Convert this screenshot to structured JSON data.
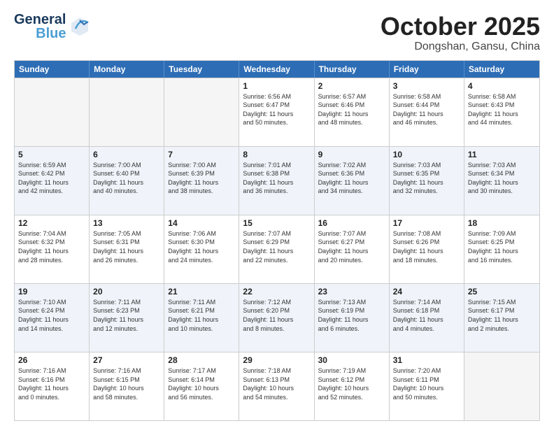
{
  "header": {
    "logo": {
      "part1": "General",
      "part2": "Blue"
    },
    "month": "October 2025",
    "location": "Dongshan, Gansu, China"
  },
  "weekdays": [
    "Sunday",
    "Monday",
    "Tuesday",
    "Wednesday",
    "Thursday",
    "Friday",
    "Saturday"
  ],
  "rows": [
    {
      "alt": false,
      "cells": [
        {
          "empty": true,
          "day": "",
          "info": ""
        },
        {
          "empty": true,
          "day": "",
          "info": ""
        },
        {
          "empty": true,
          "day": "",
          "info": ""
        },
        {
          "empty": false,
          "day": "1",
          "info": "Sunrise: 6:56 AM\nSunset: 6:47 PM\nDaylight: 11 hours\nand 50 minutes."
        },
        {
          "empty": false,
          "day": "2",
          "info": "Sunrise: 6:57 AM\nSunset: 6:46 PM\nDaylight: 11 hours\nand 48 minutes."
        },
        {
          "empty": false,
          "day": "3",
          "info": "Sunrise: 6:58 AM\nSunset: 6:44 PM\nDaylight: 11 hours\nand 46 minutes."
        },
        {
          "empty": false,
          "day": "4",
          "info": "Sunrise: 6:58 AM\nSunset: 6:43 PM\nDaylight: 11 hours\nand 44 minutes."
        }
      ]
    },
    {
      "alt": true,
      "cells": [
        {
          "empty": false,
          "day": "5",
          "info": "Sunrise: 6:59 AM\nSunset: 6:42 PM\nDaylight: 11 hours\nand 42 minutes."
        },
        {
          "empty": false,
          "day": "6",
          "info": "Sunrise: 7:00 AM\nSunset: 6:40 PM\nDaylight: 11 hours\nand 40 minutes."
        },
        {
          "empty": false,
          "day": "7",
          "info": "Sunrise: 7:00 AM\nSunset: 6:39 PM\nDaylight: 11 hours\nand 38 minutes."
        },
        {
          "empty": false,
          "day": "8",
          "info": "Sunrise: 7:01 AM\nSunset: 6:38 PM\nDaylight: 11 hours\nand 36 minutes."
        },
        {
          "empty": false,
          "day": "9",
          "info": "Sunrise: 7:02 AM\nSunset: 6:36 PM\nDaylight: 11 hours\nand 34 minutes."
        },
        {
          "empty": false,
          "day": "10",
          "info": "Sunrise: 7:03 AM\nSunset: 6:35 PM\nDaylight: 11 hours\nand 32 minutes."
        },
        {
          "empty": false,
          "day": "11",
          "info": "Sunrise: 7:03 AM\nSunset: 6:34 PM\nDaylight: 11 hours\nand 30 minutes."
        }
      ]
    },
    {
      "alt": false,
      "cells": [
        {
          "empty": false,
          "day": "12",
          "info": "Sunrise: 7:04 AM\nSunset: 6:32 PM\nDaylight: 11 hours\nand 28 minutes."
        },
        {
          "empty": false,
          "day": "13",
          "info": "Sunrise: 7:05 AM\nSunset: 6:31 PM\nDaylight: 11 hours\nand 26 minutes."
        },
        {
          "empty": false,
          "day": "14",
          "info": "Sunrise: 7:06 AM\nSunset: 6:30 PM\nDaylight: 11 hours\nand 24 minutes."
        },
        {
          "empty": false,
          "day": "15",
          "info": "Sunrise: 7:07 AM\nSunset: 6:29 PM\nDaylight: 11 hours\nand 22 minutes."
        },
        {
          "empty": false,
          "day": "16",
          "info": "Sunrise: 7:07 AM\nSunset: 6:27 PM\nDaylight: 11 hours\nand 20 minutes."
        },
        {
          "empty": false,
          "day": "17",
          "info": "Sunrise: 7:08 AM\nSunset: 6:26 PM\nDaylight: 11 hours\nand 18 minutes."
        },
        {
          "empty": false,
          "day": "18",
          "info": "Sunrise: 7:09 AM\nSunset: 6:25 PM\nDaylight: 11 hours\nand 16 minutes."
        }
      ]
    },
    {
      "alt": true,
      "cells": [
        {
          "empty": false,
          "day": "19",
          "info": "Sunrise: 7:10 AM\nSunset: 6:24 PM\nDaylight: 11 hours\nand 14 minutes."
        },
        {
          "empty": false,
          "day": "20",
          "info": "Sunrise: 7:11 AM\nSunset: 6:23 PM\nDaylight: 11 hours\nand 12 minutes."
        },
        {
          "empty": false,
          "day": "21",
          "info": "Sunrise: 7:11 AM\nSunset: 6:21 PM\nDaylight: 11 hours\nand 10 minutes."
        },
        {
          "empty": false,
          "day": "22",
          "info": "Sunrise: 7:12 AM\nSunset: 6:20 PM\nDaylight: 11 hours\nand 8 minutes."
        },
        {
          "empty": false,
          "day": "23",
          "info": "Sunrise: 7:13 AM\nSunset: 6:19 PM\nDaylight: 11 hours\nand 6 minutes."
        },
        {
          "empty": false,
          "day": "24",
          "info": "Sunrise: 7:14 AM\nSunset: 6:18 PM\nDaylight: 11 hours\nand 4 minutes."
        },
        {
          "empty": false,
          "day": "25",
          "info": "Sunrise: 7:15 AM\nSunset: 6:17 PM\nDaylight: 11 hours\nand 2 minutes."
        }
      ]
    },
    {
      "alt": false,
      "cells": [
        {
          "empty": false,
          "day": "26",
          "info": "Sunrise: 7:16 AM\nSunset: 6:16 PM\nDaylight: 11 hours\nand 0 minutes."
        },
        {
          "empty": false,
          "day": "27",
          "info": "Sunrise: 7:16 AM\nSunset: 6:15 PM\nDaylight: 10 hours\nand 58 minutes."
        },
        {
          "empty": false,
          "day": "28",
          "info": "Sunrise: 7:17 AM\nSunset: 6:14 PM\nDaylight: 10 hours\nand 56 minutes."
        },
        {
          "empty": false,
          "day": "29",
          "info": "Sunrise: 7:18 AM\nSunset: 6:13 PM\nDaylight: 10 hours\nand 54 minutes."
        },
        {
          "empty": false,
          "day": "30",
          "info": "Sunrise: 7:19 AM\nSunset: 6:12 PM\nDaylight: 10 hours\nand 52 minutes."
        },
        {
          "empty": false,
          "day": "31",
          "info": "Sunrise: 7:20 AM\nSunset: 6:11 PM\nDaylight: 10 hours\nand 50 minutes."
        },
        {
          "empty": true,
          "day": "",
          "info": ""
        }
      ]
    }
  ]
}
